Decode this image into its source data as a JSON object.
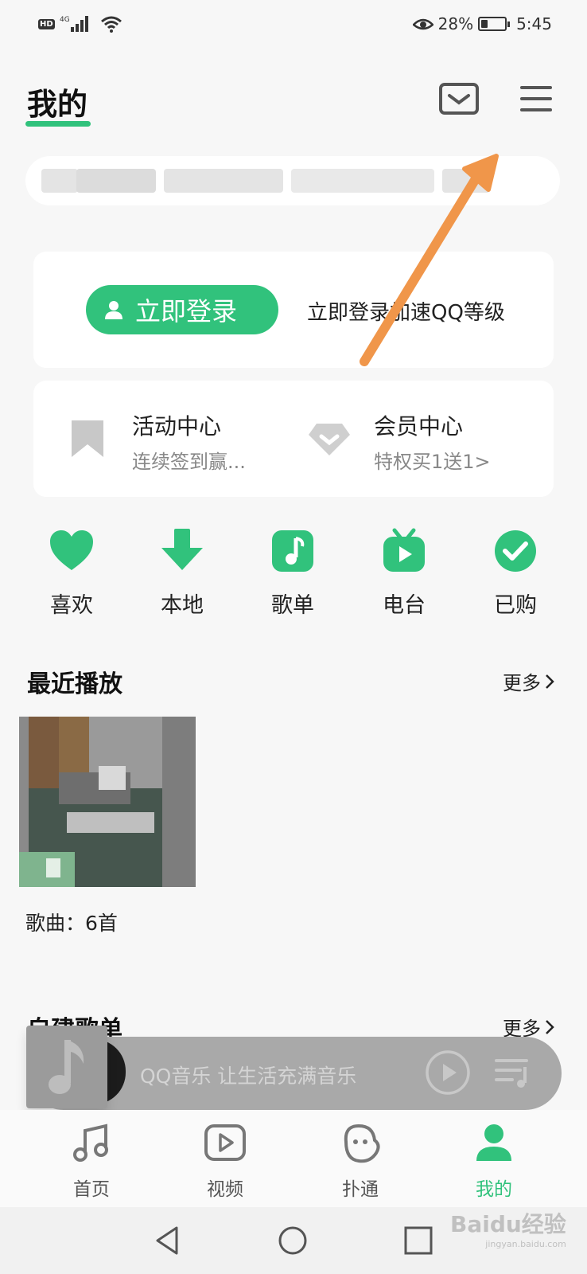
{
  "status_bar": {
    "hd_badge": "HD",
    "network": "4G",
    "battery": "28%",
    "battery_level": 0.28,
    "time": "5:45"
  },
  "header": {
    "title": "我的"
  },
  "login_card": {
    "login_button": "立即登录",
    "hint": "立即登录加速QQ等级"
  },
  "centers": [
    {
      "title": "活动中心",
      "subtitle": "连续签到赢...",
      "icon": "bookmark-icon"
    },
    {
      "title": "会员中心",
      "subtitle": "特权买1送1>",
      "icon": "diamond-icon"
    }
  ],
  "quick_actions": [
    {
      "label": "喜欢",
      "icon": "heart-icon"
    },
    {
      "label": "本地",
      "icon": "download-icon"
    },
    {
      "label": "歌单",
      "icon": "music-note-icon"
    },
    {
      "label": "电台",
      "icon": "tv-icon"
    },
    {
      "label": "已购",
      "icon": "check-icon"
    }
  ],
  "recent": {
    "title": "最近播放",
    "more": "更多",
    "caption": "歌曲：6首"
  },
  "playlists": {
    "title": "自建歌单",
    "more": "更多"
  },
  "player": {
    "text": "QQ音乐 让生活充满音乐"
  },
  "tabs": [
    {
      "label": "首页",
      "icon": "music-icon"
    },
    {
      "label": "视频",
      "icon": "video-icon"
    },
    {
      "label": "扑通",
      "icon": "face-icon"
    },
    {
      "label": "我的",
      "icon": "person-icon"
    }
  ],
  "watermark": {
    "text": "Baidu经验",
    "url": "jingyan.baidu.com"
  },
  "colors": {
    "accent": "#31c27c",
    "annotation_arrow": "#f0964a"
  }
}
